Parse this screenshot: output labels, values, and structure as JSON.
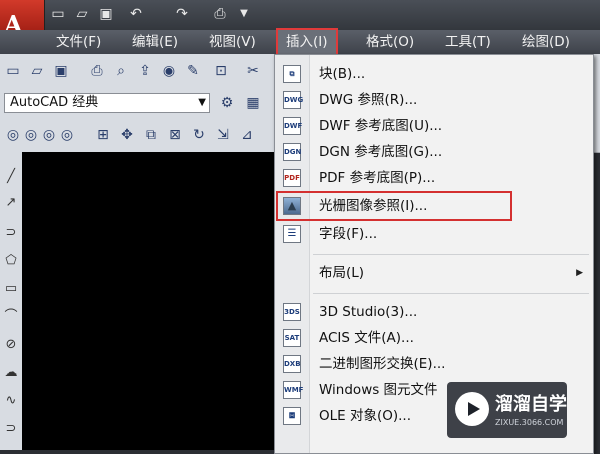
{
  "menu": {
    "items": [
      {
        "label": "文件(F)"
      },
      {
        "label": "编辑(E)"
      },
      {
        "label": "视图(V)"
      },
      {
        "label": "插入(I)"
      },
      {
        "label": "格式(O)"
      },
      {
        "label": "工具(T)"
      },
      {
        "label": "绘图(D)"
      }
    ]
  },
  "toolbar": {
    "workspace": "AutoCAD 经典"
  },
  "insert_menu": {
    "items": [
      {
        "label": "块(B)...",
        "icon": "block-icon"
      },
      {
        "label": "DWG 参照(R)...",
        "icon": "dwg-icon",
        "badge": "DWG"
      },
      {
        "label": "DWF 参考底图(U)...",
        "icon": "dwf-icon",
        "badge": "DWF"
      },
      {
        "label": "DGN 参考底图(G)...",
        "icon": "dgn-icon",
        "badge": "DGN"
      },
      {
        "label": "PDF 参考底图(P)...",
        "icon": "pdf-icon",
        "badge": "PDF"
      },
      {
        "label": "光栅图像参照(I)...",
        "icon": "raster-image-icon"
      },
      {
        "label": "字段(F)...",
        "icon": "field-icon"
      },
      {
        "label": "布局(L)",
        "icon": ""
      },
      {
        "label": "3D Studio(3)...",
        "icon": "3ds-icon",
        "badge": "3DS"
      },
      {
        "label": "ACIS 文件(A)...",
        "icon": "acis-icon",
        "badge": "SAT"
      },
      {
        "label": "二进制图形交换(E)...",
        "icon": "dxb-icon",
        "badge": "DXB"
      },
      {
        "label": "Windows 图元文件",
        "icon": "wmf-icon",
        "badge": "WMF"
      },
      {
        "label": "OLE 对象(O)...",
        "icon": "ole-icon"
      }
    ],
    "highlighted": "光栅图像参照(I)..."
  },
  "watermark": {
    "title": "溜溜自学",
    "subtitle": "ZIXUE.3066.COM"
  },
  "colors": {
    "highlight_border": "#d43030",
    "menubar": "#4a4f57",
    "canvas": "#000000"
  }
}
